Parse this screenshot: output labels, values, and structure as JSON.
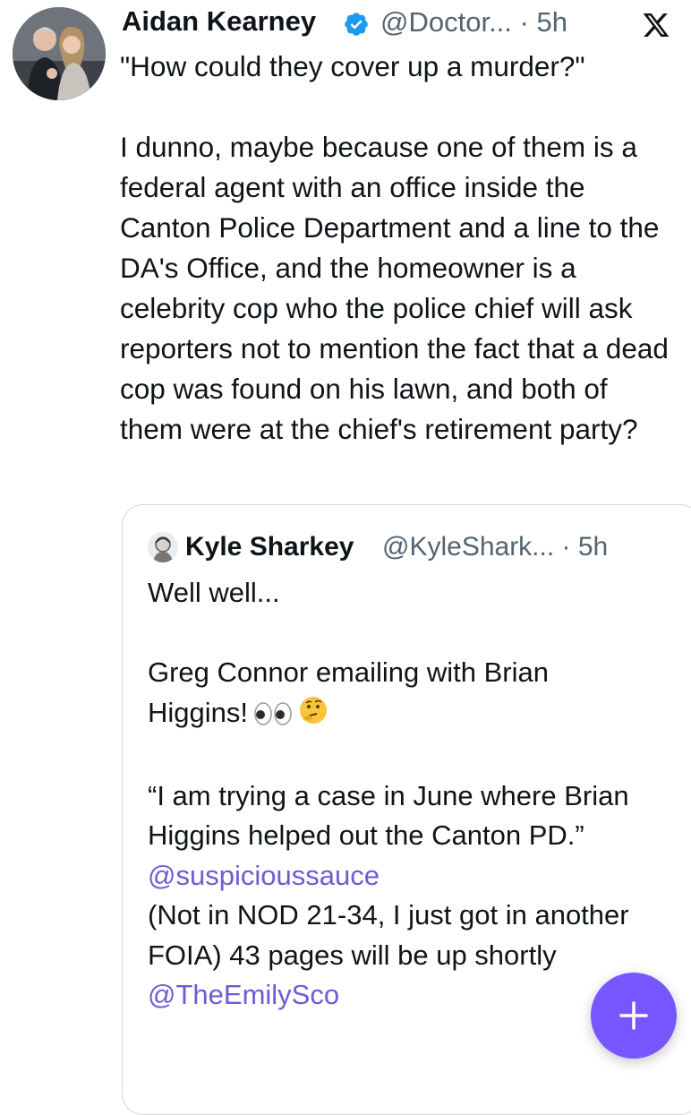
{
  "tweet": {
    "author_name": "Aidan Kearney",
    "handle_time": "@Doctor... · 5h",
    "verified_icon": "verified-badge-icon",
    "text": "\"How could they cover up a murder?\"\n\nI dunno, maybe because one of them is a federal agent with an office inside the Canton Police Department and a line to the DA's Office, and the homeowner is a celebrity cop who the police chief will ask reporters not to mention the fact that a dead cop was found on his lawn, and both of them were at the chief's retirement party?"
  },
  "quote": {
    "author_name": "Kyle Sharkey",
    "handle_time": "@KyleShark... · 5h",
    "line1": "Well well...",
    "line2": "Greg Connor emailing with Brian Higgins!",
    "line3": "“I am trying a case in June where Brian Higgins helped out the Canton PD.”",
    "mention1": "@suspicioussauce",
    "line4": "(Not in NOD 21-34, I just got in another FOIA) 43 pages will be up shortly",
    "mention2": "@TheEmilySco"
  },
  "colors": {
    "text": "#0f1419",
    "secondary": "#536471",
    "mention": "#6a5dd6",
    "verified": "#1d9bf0",
    "fab": "#7856ff"
  },
  "icons": {
    "x_logo": "x-logo-icon",
    "fab": "plus-icon",
    "emoji1": "eyes-emoji",
    "emoji2": "thinking-face-emoji"
  }
}
